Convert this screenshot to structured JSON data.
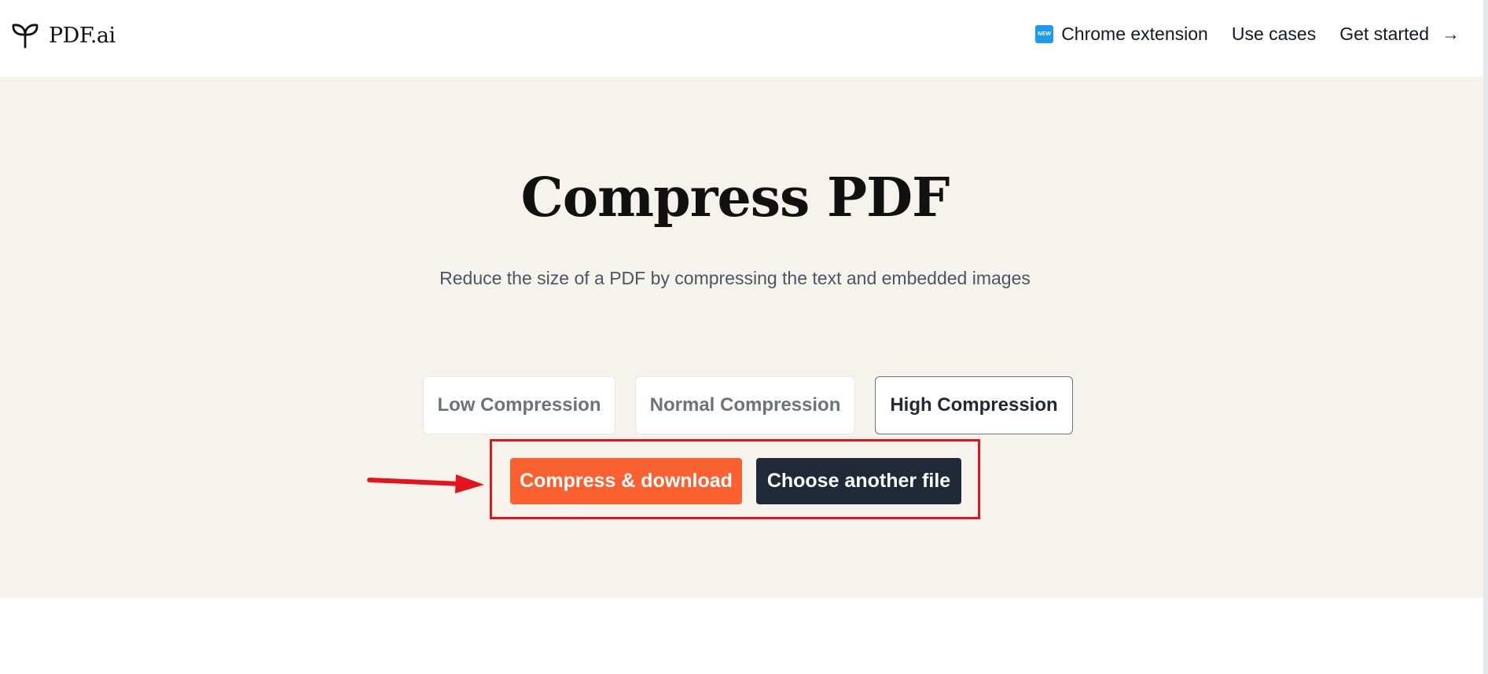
{
  "header": {
    "logo_text": "PDF.ai",
    "nav": [
      {
        "label": "Chrome extension",
        "badge": "NEW"
      },
      {
        "label": "Use cases"
      },
      {
        "label": "Get started",
        "arrow": "→"
      }
    ]
  },
  "hero": {
    "title": "Compress PDF",
    "subtitle": "Reduce the size of a PDF by compressing the text and embedded images"
  },
  "compression_options": {
    "low": "Low Compression",
    "normal": "Normal Compression",
    "high": "High Compression",
    "selected": "high"
  },
  "actions": {
    "compress_label": "Compress & download",
    "choose_label": "Choose another file"
  },
  "colors": {
    "hero_bg": "#f6f3ed",
    "accent_orange": "#fb6130",
    "dark_button": "#1f2937",
    "annotation_red": "#e3141c",
    "badge_blue": "#1d9bf0"
  }
}
